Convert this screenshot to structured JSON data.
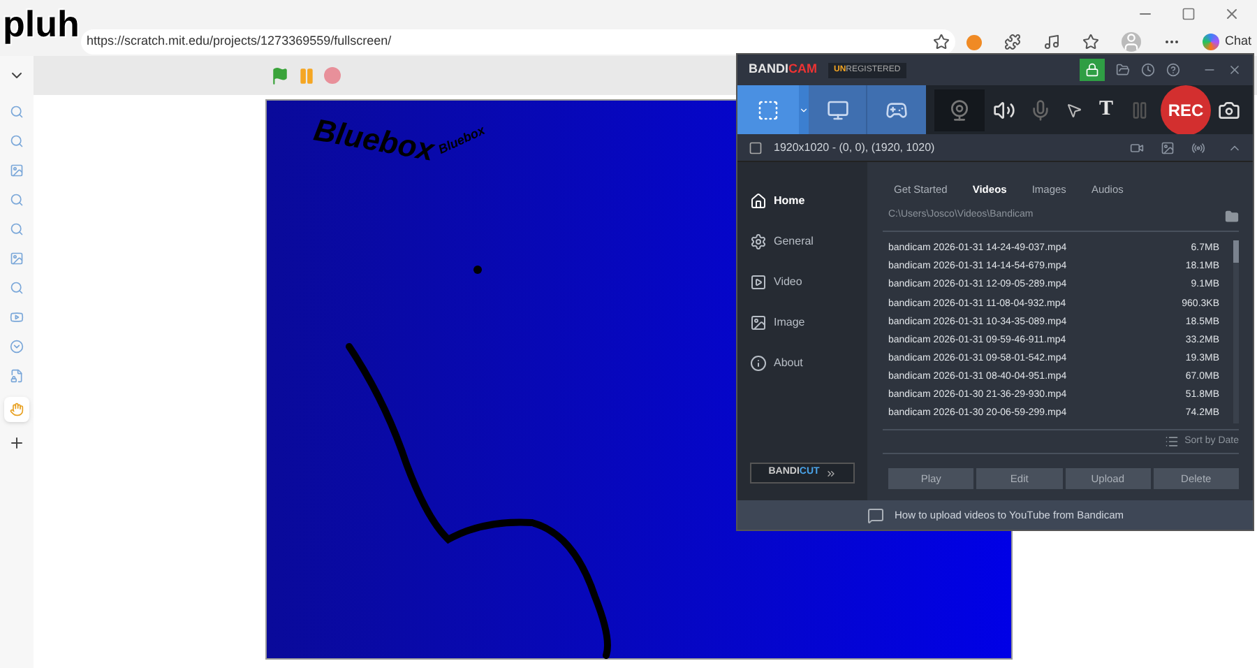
{
  "browser": {
    "caption": "pluh",
    "url": "https://scratch.mit.edu/projects/1273369559/fullscreen/",
    "chat_label": "Chat"
  },
  "stage": {
    "title": "Bluebox",
    "subtitle": "Bluebox"
  },
  "bandicam": {
    "brand_a": "BANDI",
    "brand_b": "CAM",
    "badge_a": "UN",
    "badge_b": "REGISTERED",
    "text_tool": "T",
    "rec_label": "REC",
    "area": "1920x1020 - (0, 0), (1920, 1020)",
    "nav": [
      {
        "label": "Home",
        "kind": "home",
        "selected": true
      },
      {
        "label": "General",
        "kind": "general",
        "selected": false
      },
      {
        "label": "Video",
        "kind": "video",
        "selected": false
      },
      {
        "label": "Image",
        "kind": "image",
        "selected": false
      },
      {
        "label": "About",
        "kind": "about",
        "selected": false
      }
    ],
    "tabs": [
      {
        "label": "Get Started",
        "selected": false
      },
      {
        "label": "Videos",
        "selected": true
      },
      {
        "label": "Images",
        "selected": false
      },
      {
        "label": "Audios",
        "selected": false
      }
    ],
    "folder": "C:\\Users\\Josco\\Videos\\Bandicam",
    "files": [
      {
        "name": "bandicam 2026-01-31 14-24-49-037.mp4",
        "size": "6.7MB"
      },
      {
        "name": "bandicam 2026-01-31 14-14-54-679.mp4",
        "size": "18.1MB"
      },
      {
        "name": "bandicam 2026-01-31 12-09-05-289.mp4",
        "size": "9.1MB"
      },
      {
        "name": "bandicam 2026-01-31 11-08-04-932.mp4",
        "size": "960.3KB"
      },
      {
        "name": "bandicam 2026-01-31 10-34-35-089.mp4",
        "size": "18.5MB"
      },
      {
        "name": "bandicam 2026-01-31 09-59-46-911.mp4",
        "size": "33.2MB"
      },
      {
        "name": "bandicam 2026-01-31 09-58-01-542.mp4",
        "size": "19.3MB"
      },
      {
        "name": "bandicam 2026-01-31 08-40-04-951.mp4",
        "size": "67.0MB"
      },
      {
        "name": "bandicam 2026-01-30 21-36-29-930.mp4",
        "size": "51.8MB"
      },
      {
        "name": "bandicam 2026-01-30 20-06-59-299.mp4",
        "size": "74.2MB"
      }
    ],
    "sort_label": "Sort by Date",
    "actions": [
      "Play",
      "Edit",
      "Upload",
      "Delete"
    ],
    "bandicut_a": "BANDI",
    "bandicut_b": "CUT",
    "tip": "How to upload videos to YouTube from Bandicam"
  }
}
